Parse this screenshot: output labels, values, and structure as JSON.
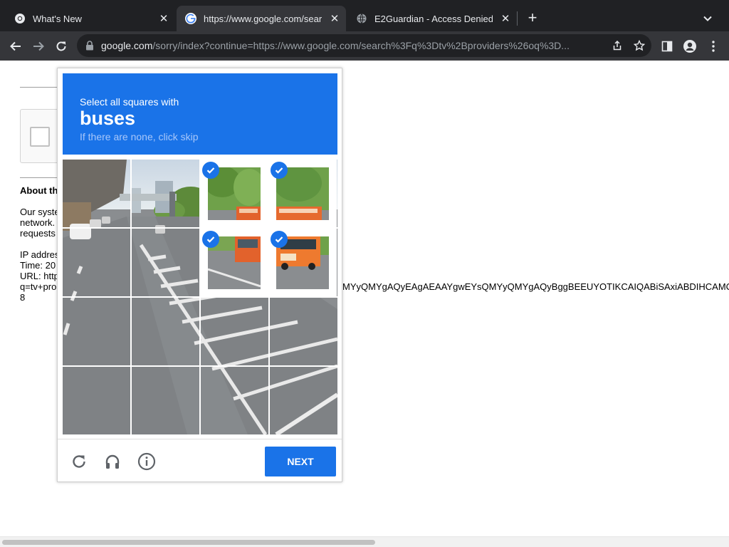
{
  "browser": {
    "tabs": [
      {
        "title": "What's New",
        "icon": "chrome-icon",
        "active": false
      },
      {
        "title": "https://www.google.com/sear",
        "icon": "google-icon",
        "active": true
      },
      {
        "title": "E2Guardian - Access Denied",
        "icon": "globe-icon",
        "active": false
      }
    ],
    "new_tab": "+",
    "address_bar": {
      "host": "google.com",
      "path": "/sorry/index?continue=https://www.google.com/search%3Fq%3Dtv%2Bproviders%26oq%3D..."
    }
  },
  "page": {
    "about_heading": "About th",
    "para1": [
      "Our syste",
      "network.",
      "requests"
    ],
    "ip_label": "IP addres",
    "time_label": "Time: 20",
    "url_label": "URL: http",
    "url_cont": "q=tv+pro",
    "url_tail": "MYyQMYgAQyEAgAEAAYgwEYsQMYyQMYgAQyBggBEEUYOTIKCAIQABiSAxiABDIHCAMC",
    "url_last": "8"
  },
  "captcha": {
    "instruction": "Select all squares with",
    "target": "buses",
    "hint": "If there are none, click skip",
    "next_label": "NEXT",
    "colors": {
      "accent": "#1a73e8"
    },
    "selected_tiles": [
      [
        0,
        2
      ],
      [
        0,
        3
      ],
      [
        1,
        2
      ],
      [
        1,
        3
      ]
    ],
    "footer_icons": [
      "reload-icon",
      "audio-headphones-icon",
      "info-icon"
    ]
  }
}
